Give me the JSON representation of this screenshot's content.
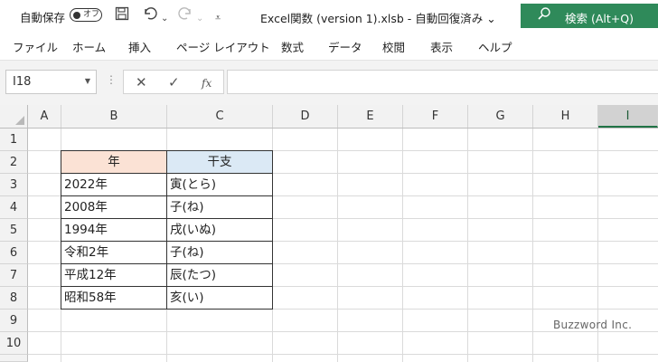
{
  "titlebar": {
    "autosave_label": "自動保存",
    "toggle_state": "オフ",
    "document_title": "Excel関数 (version 1).xlsb  -  自動回復済み  ⌄",
    "search_label": "検索 (Alt+Q)",
    "save_icon": "floppy-disk-icon",
    "undo_icon": "undo-icon",
    "redo_icon": "redo-icon",
    "customize_icon": "customize-quick-access-icon"
  },
  "ribbon": {
    "tabs": [
      "ファイル",
      "ホーム",
      "挿入",
      "ページ レイアウト",
      "数式",
      "データ",
      "校閲",
      "表示",
      "ヘルプ"
    ]
  },
  "formula_bar": {
    "name_box": "I18",
    "formula": "",
    "cancel_symbol": "✕",
    "enter_symbol": "✓",
    "fx_symbol": "fx"
  },
  "sheet": {
    "columns": [
      "A",
      "B",
      "C",
      "D",
      "E",
      "F",
      "G",
      "H",
      "I"
    ],
    "active_column": "I",
    "rows": [
      "1",
      "2",
      "3",
      "4",
      "5",
      "6",
      "7",
      "8",
      "9",
      "10"
    ],
    "table": {
      "header": [
        "年",
        "干支"
      ],
      "rows": [
        [
          "2022年",
          "寅(とら)"
        ],
        [
          "2008年",
          "子(ね)"
        ],
        [
          "1994年",
          "戌(いぬ)"
        ],
        [
          "令和2年",
          "子(ね)"
        ],
        [
          "平成12年",
          "辰(たつ)"
        ],
        [
          "昭和58年",
          "亥(い)"
        ]
      ]
    },
    "colors": {
      "header_year_bg": "#fbe2d5",
      "header_eto_bg": "#dbe9f5",
      "accent": "#217346"
    }
  },
  "watermark": "Buzzword Inc."
}
